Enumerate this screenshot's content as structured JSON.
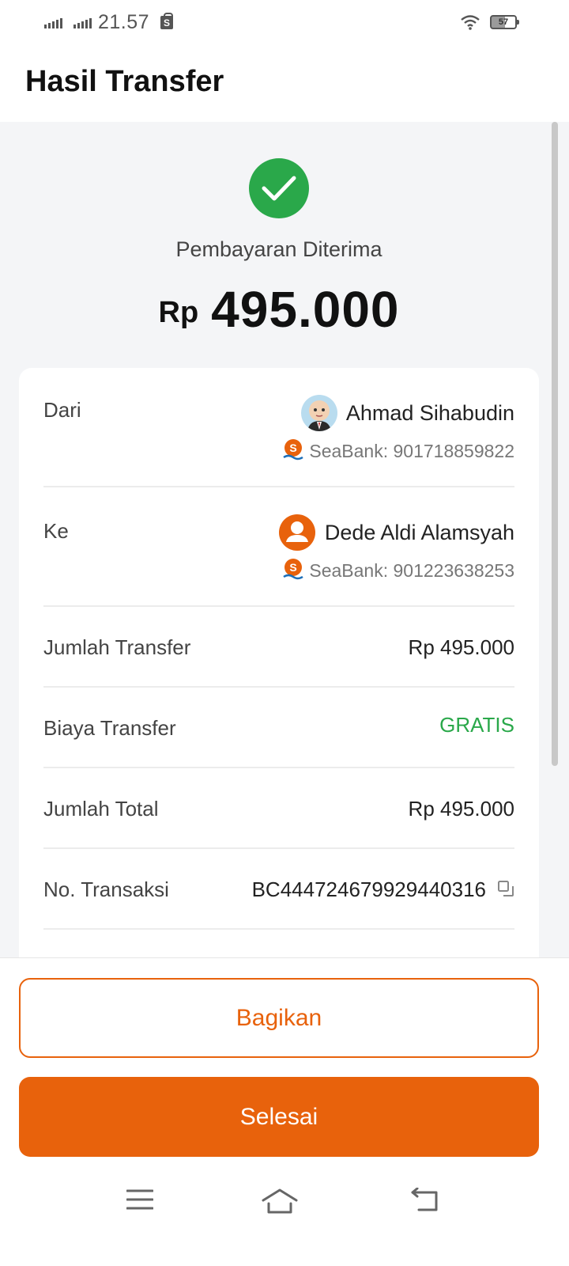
{
  "status_bar": {
    "time": "21.57",
    "battery": "57"
  },
  "header": {
    "title": "Hasil Transfer"
  },
  "result": {
    "status": "Pembayaran Diterima",
    "currency": "Rp",
    "amount": "495.000"
  },
  "details": {
    "from": {
      "label": "Dari",
      "name": "Ahmad Sihabudin",
      "bank": "SeaBank: 901718859822"
    },
    "to": {
      "label": "Ke",
      "name": "Dede Aldi Alamsyah",
      "bank": "SeaBank: 901223638253"
    },
    "rows": [
      {
        "label": "Jumlah Transfer",
        "value": "Rp 495.000"
      },
      {
        "label": "Biaya Transfer",
        "value": "GRATIS"
      },
      {
        "label": "Jumlah Total",
        "value": "Rp 495.000"
      },
      {
        "label": "No. Transaksi",
        "value": "BC444724679929440316"
      }
    ]
  },
  "buttons": {
    "share": "Bagikan",
    "done": "Selesai"
  },
  "colors": {
    "accent": "#e8620c",
    "success": "#2aa84a"
  },
  "icons": [
    "signal-icon",
    "shopping-bag-icon",
    "wifi-icon",
    "battery-icon",
    "check-icon",
    "seabank-logo-icon",
    "user-icon",
    "copy-icon",
    "menu-icon",
    "home-icon",
    "back-icon"
  ]
}
